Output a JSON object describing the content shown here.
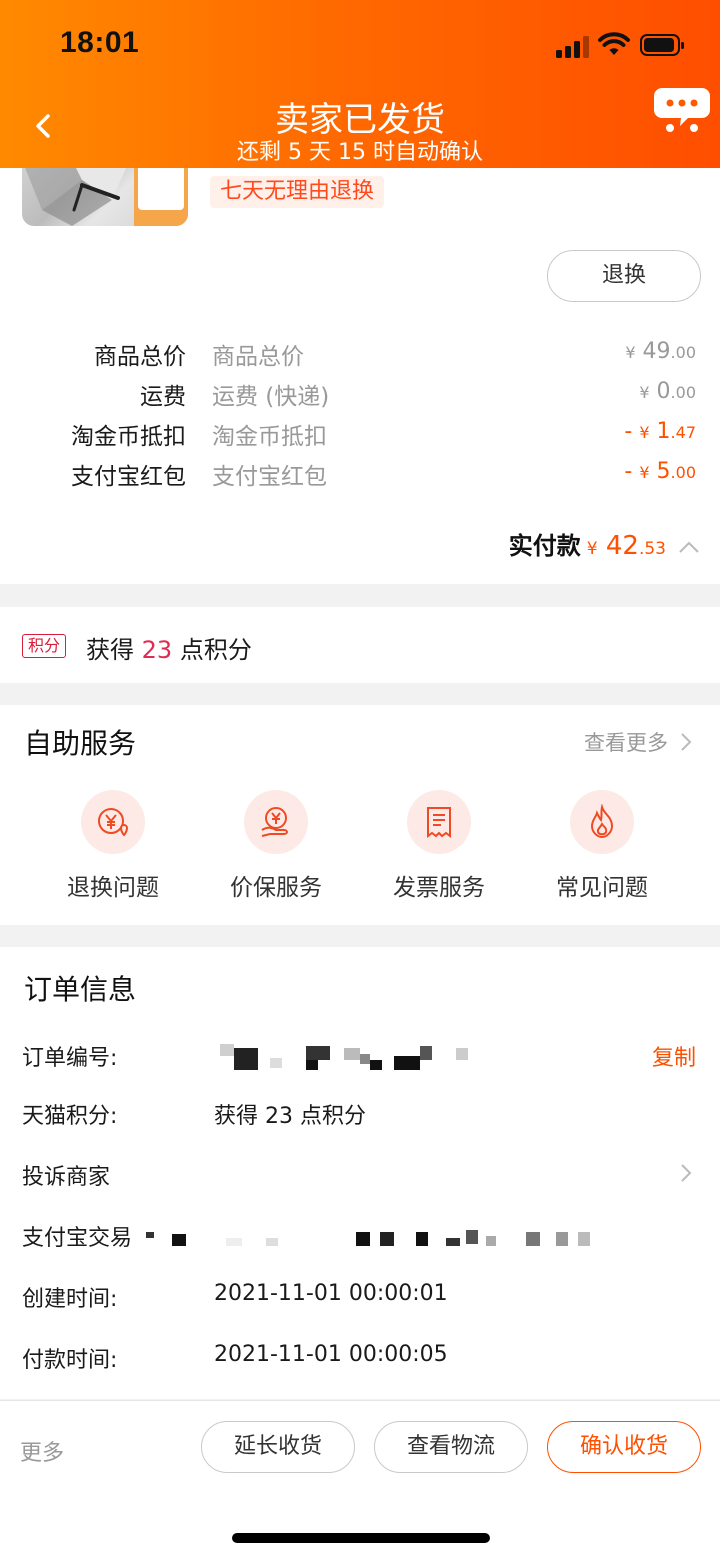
{
  "status": {
    "time": "18:01"
  },
  "header": {
    "title": "卖家已发货",
    "subtitle": "还剩 5 天 15 时自动确认",
    "back_icon": "chevron-left-icon",
    "chat_icon": "chat-bubble-icon",
    "gradient": [
      "#ff8a00",
      "#ff4e00"
    ]
  },
  "product": {
    "tag": "七天无理由退换",
    "refund_button": "退换"
  },
  "fees": [
    {
      "label": "商品总价",
      "desc": "商品总价",
      "currency": "¥",
      "int": "49",
      "dec": ".00",
      "prefix": ""
    },
    {
      "label": "运费",
      "desc": "运费 (快递)",
      "currency": "¥",
      "int": "0",
      "dec": ".00",
      "prefix": ""
    },
    {
      "label": "淘金币抵扣",
      "desc": "淘金币抵扣",
      "currency": "¥",
      "int": "1",
      "dec": ".47",
      "prefix": "-"
    },
    {
      "label": "支付宝红包",
      "desc": "支付宝红包",
      "currency": "¥",
      "int": "5",
      "dec": ".00",
      "prefix": "-"
    }
  ],
  "paid": {
    "label": "实付款",
    "currency": "¥",
    "int": "42",
    "dec": ".53"
  },
  "points": {
    "badge": "积分",
    "pre": "获得",
    "num": "23",
    "post": "点积分"
  },
  "self_service": {
    "title": "自助服务",
    "more": "查看更多",
    "items": [
      {
        "label": "退换问题",
        "icon": "yuan-refund-icon"
      },
      {
        "label": "价保服务",
        "icon": "price-protect-icon"
      },
      {
        "label": "发票服务",
        "icon": "invoice-icon"
      },
      {
        "label": "常见问题",
        "icon": "flame-icon"
      }
    ]
  },
  "order_info": {
    "title": "订单信息",
    "order_no_label": "订单编号:",
    "copy": "复制",
    "tmall_points_label": "天猫积分:",
    "tmall_points_value": "获得 23 点积分",
    "complaint_label": "投诉商家",
    "alipay_label": "支付宝交易",
    "created_label": "创建时间:",
    "created_value": "2021-11-01 00:00:01",
    "paid_label": "付款时间:",
    "paid_value": "2021-11-01 00:00:05"
  },
  "footer": {
    "more": "更多",
    "extend": "延长收货",
    "logistics": "查看物流",
    "confirm": "确认收货"
  },
  "colors": {
    "accent": "#ff5000",
    "points": "#e02b54"
  }
}
